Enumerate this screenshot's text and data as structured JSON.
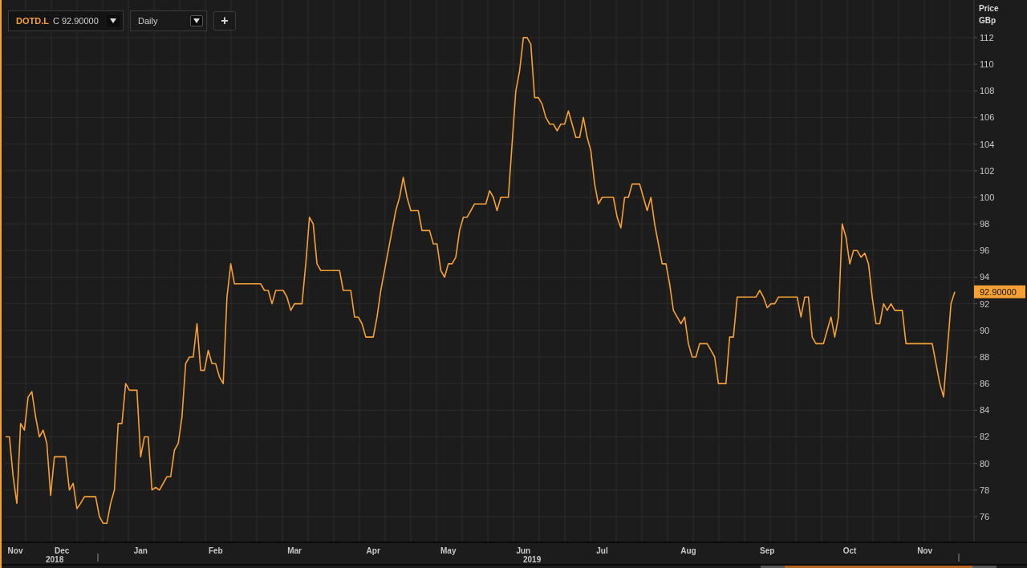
{
  "toolbar": {
    "instrument": {
      "price": "C 92.90000"
    },
    "interval": {
      "value": "Daily"
    },
    "add_button": {
      "label": "+"
    }
  },
  "chart": {
    "axis_title": "Price",
    "axis_unit": "GBp",
    "last_price": "92.90000",
    "years": [
      "2018",
      "2019"
    ],
    "chart_data": {
      "type": "line",
      "grid": true,
      "ylim": [
        74.07,
        114.83
      ],
      "yticks": [
        76,
        78,
        80,
        82,
        84,
        86,
        88,
        90,
        92,
        94,
        96,
        98,
        100,
        102,
        104,
        106,
        108,
        110,
        112
      ],
      "categories": [
        null,
        null,
        "Nov",
        null,
        null,
        null,
        null,
        null,
        null,
        null,
        null,
        null,
        null,
        null,
        null,
        "Dec",
        null,
        null,
        null,
        null,
        null,
        null,
        null,
        null,
        null,
        null,
        null,
        null,
        null,
        null,
        null,
        null,
        null,
        null,
        null,
        null,
        "Jan",
        null,
        null,
        null,
        null,
        null,
        null,
        null,
        null,
        null,
        null,
        null,
        null,
        null,
        null,
        null,
        null,
        null,
        null,
        null,
        "Feb",
        null,
        null,
        null,
        null,
        null,
        null,
        null,
        null,
        null,
        null,
        null,
        null,
        null,
        null,
        null,
        null,
        null,
        null,
        null,
        null,
        "Mar",
        null,
        null,
        null,
        null,
        null,
        null,
        null,
        null,
        null,
        null,
        null,
        null,
        null,
        null,
        null,
        null,
        null,
        null,
        null,
        null,
        "Apr",
        null,
        null,
        null,
        null,
        null,
        null,
        null,
        null,
        null,
        null,
        null,
        null,
        null,
        null,
        null,
        null,
        null,
        null,
        null,
        "May",
        null,
        null,
        null,
        null,
        null,
        null,
        null,
        null,
        null,
        null,
        null,
        null,
        null,
        null,
        null,
        null,
        null,
        null,
        null,
        "Jun",
        null,
        null,
        null,
        null,
        null,
        null,
        null,
        null,
        null,
        null,
        null,
        null,
        null,
        null,
        null,
        null,
        null,
        null,
        null,
        null,
        "Jul",
        null,
        null,
        null,
        null,
        null,
        null,
        null,
        null,
        null,
        null,
        null,
        null,
        null,
        null,
        null,
        null,
        null,
        null,
        null,
        null,
        null,
        null,
        "Aug",
        null,
        null,
        null,
        null,
        null,
        null,
        null,
        null,
        null,
        null,
        null,
        null,
        null,
        null,
        null,
        null,
        null,
        null,
        null,
        null,
        "Sep",
        null,
        null,
        null,
        null,
        null,
        null,
        null,
        null,
        null,
        null,
        null,
        null,
        null,
        null,
        null,
        null,
        null,
        null,
        null,
        null,
        null,
        "Oct",
        null,
        null,
        null,
        null,
        null,
        null,
        null,
        null,
        null,
        null,
        null,
        null,
        null,
        null,
        null,
        null,
        null,
        null,
        null,
        "Nov",
        null,
        null,
        null,
        null,
        null,
        null,
        null,
        null
      ],
      "series": [
        {
          "name": "DOTD.L",
          "color": "#f7a035",
          "values": [
            82,
            82,
            79,
            77,
            83,
            82.5,
            85,
            85.4,
            83.5,
            82,
            82.5,
            81.5,
            77.6,
            80.5,
            80.5,
            80.5,
            80.5,
            78,
            78.5,
            76.6,
            77,
            77.5,
            77.5,
            77.5,
            77.5,
            76,
            75.5,
            75.5,
            77,
            78,
            83,
            83,
            86,
            85.5,
            85.5,
            85.5,
            80.5,
            82,
            82,
            78,
            78.2,
            78,
            78.5,
            79,
            79,
            81,
            81.5,
            83.5,
            87.5,
            88,
            88,
            90.5,
            87,
            87,
            88.5,
            87.5,
            87.5,
            86.5,
            86,
            92.5,
            95,
            93.5,
            93.5,
            93.5,
            93.5,
            93.5,
            93.5,
            93.5,
            93.5,
            93,
            93,
            92,
            93,
            93,
            93,
            92.5,
            91.5,
            92,
            92,
            92,
            95,
            98.5,
            98,
            95,
            94.5,
            94.5,
            94.5,
            94.5,
            94.5,
            94.5,
            93,
            93,
            93,
            91,
            91,
            90.5,
            89.5,
            89.5,
            89.5,
            91,
            93,
            94.5,
            96,
            97.5,
            99,
            100,
            101.5,
            100,
            99,
            99,
            99,
            97.5,
            97.5,
            97.5,
            96.5,
            96.5,
            94.5,
            94,
            95,
            95,
            95.5,
            97.5,
            98.5,
            98.5,
            99,
            99.5,
            99.5,
            99.5,
            99.5,
            100.5,
            100,
            99,
            100,
            100,
            100,
            104,
            108,
            109.5,
            112,
            112,
            111.5,
            107.5,
            107.5,
            107,
            106,
            105.5,
            105.5,
            105,
            105.5,
            105.5,
            106.5,
            105.5,
            104.5,
            104.5,
            106,
            104.5,
            103.5,
            101,
            99.5,
            100,
            100,
            100,
            100,
            98.5,
            97.7,
            100,
            100,
            101,
            101,
            101,
            100,
            99,
            100,
            98,
            96.5,
            95,
            95,
            93.5,
            91.5,
            91,
            90.5,
            91,
            89,
            88,
            88,
            89,
            89,
            89,
            88.5,
            88,
            86,
            86,
            86,
            89.5,
            89.5,
            92.5,
            92.5,
            92.5,
            92.5,
            92.5,
            92.5,
            93,
            92.5,
            91.7,
            92,
            92,
            92.5,
            92.5,
            92.5,
            92.5,
            92.5,
            92.5,
            91,
            92.5,
            92.5,
            89.5,
            89,
            89,
            89,
            90,
            91,
            89.5,
            91,
            98,
            97,
            95,
            96,
            96,
            95.5,
            95.8,
            95,
            92.5,
            90.5,
            90.5,
            92,
            91.5,
            92,
            91.5,
            91.5,
            91.5,
            89,
            89,
            89,
            89,
            89,
            89,
            89,
            89,
            87.5,
            86,
            85,
            88.5,
            92,
            92.9
          ]
        }
      ]
    }
  }
}
